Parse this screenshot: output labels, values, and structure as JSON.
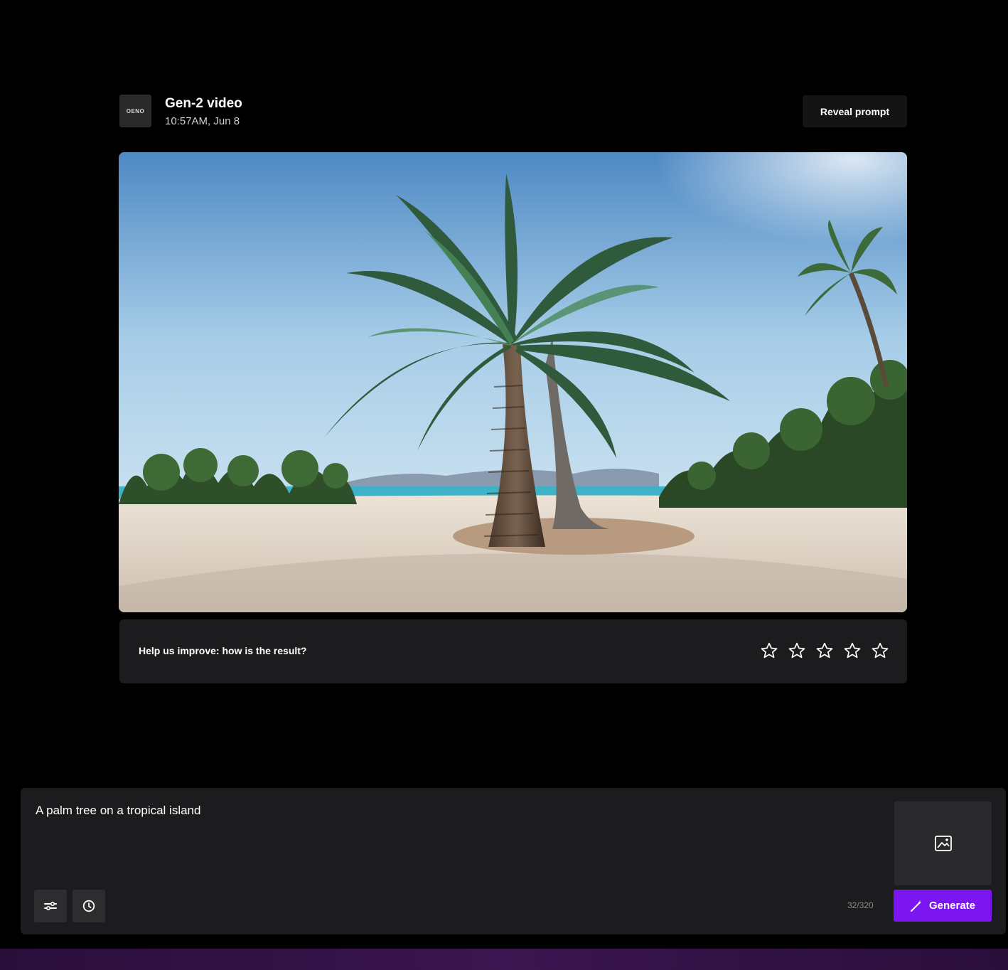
{
  "header": {
    "thumbnail_text": "OENO",
    "title": "Gen-2 video",
    "timestamp": "10:57AM, Jun 8",
    "reveal_prompt_label": "Reveal prompt"
  },
  "rating": {
    "label": "Help us improve: how is the result?",
    "max_stars": 5,
    "selected_stars": 0
  },
  "composer": {
    "prompt_value": "A palm tree on a tropical island",
    "char_count": "32/320",
    "generate_label": "Generate"
  },
  "icons": {
    "image_upload": "image-icon",
    "settings": "sliders-icon",
    "history": "clock-icon",
    "generate": "magic-wand-icon",
    "star": "star-outline-icon"
  },
  "colors": {
    "background": "#000000",
    "panel": "#1c1c1e",
    "accent": "#7b16f0"
  }
}
